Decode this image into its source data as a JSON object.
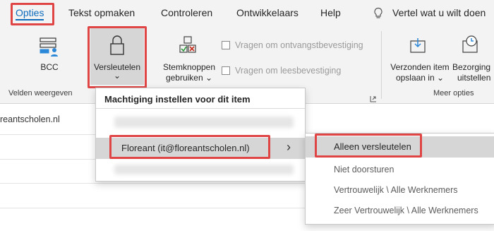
{
  "ribbon_tabs": [
    {
      "label": "Opties",
      "active": true
    },
    {
      "label": "Tekst opmaken"
    },
    {
      "label": "Controleren"
    },
    {
      "label": "Ontwikkelaars"
    },
    {
      "label": "Help"
    },
    {
      "label": "Vertel wat u wilt doen"
    }
  ],
  "ribbon": {
    "bcc_label": "BCC",
    "encrypt_label": "Versleutelen",
    "encrypt_chevron": "⌄",
    "voting_label_1": "Stemknoppen",
    "voting_label_2": "gebruiken ⌄",
    "check_receipt": "Vragen om ontvangstbevestiging",
    "check_read": "Vragen om leesbevestiging",
    "save_sent_1": "Verzonden item",
    "save_sent_2": "opslaan in ⌄",
    "delay_1": "Bezorging",
    "delay_2": "uitstellen",
    "group_show_fields": "Velden weergeven",
    "group_more_options": "Meer opties"
  },
  "recipient_fragment": "reantscholen.nl",
  "permission_menu": {
    "header": "Machtiging instellen voor dit item",
    "account_item": "Floreant (it@floreantscholen.nl)",
    "submenu_arrow": "›"
  },
  "permission_submenu": {
    "items": [
      "Alleen versleutelen",
      "Niet doorsturen",
      "Vertrouwelijk \\ Alle Werknemers",
      "Zeer Vertrouwelijk \\ Alle Werknemers"
    ]
  },
  "colors": {
    "highlight_box": "#e04545",
    "accent": "#0f6cbd",
    "ribbon_bg": "#f3f3f3",
    "selected_bg": "#d6d6d6"
  }
}
